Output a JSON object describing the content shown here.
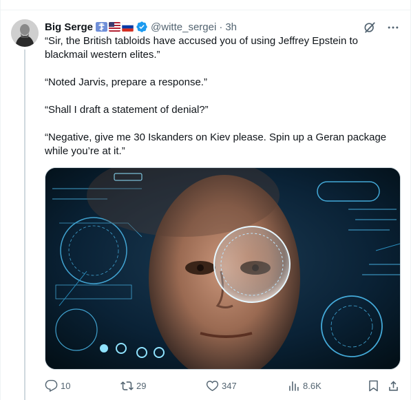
{
  "tweet": {
    "author_name": "Big Serge",
    "handle": "@witte_sergei",
    "separator": "·",
    "time": "3h",
    "paragraphs": [
      "“Sir, the British tabloids have accused you of using Jeffrey Epstein to blackmail western elites.”",
      "“Noted Jarvis, prepare a response.”",
      "“Shall I draft a statement of denial?”",
      "“Negative, give me 30 Iskanders on Kiev please. Spin up a Geran package while you’re at it.”"
    ]
  },
  "badges": [
    {
      "icon": "orthodox-cross-icon",
      "color": "#6f8fd8"
    },
    {
      "icon": "us-flag-icon",
      "color": "#b22234"
    },
    {
      "icon": "russia-flag-icon",
      "color": "#0039a6"
    }
  ],
  "verified_color": "#1d9bf0",
  "metrics": {
    "replies": "10",
    "reposts": "29",
    "likes": "347",
    "views": "8.6K"
  },
  "icons": {
    "more": "more-options-icon",
    "grok": "grok-icon",
    "reply": "reply-icon",
    "repost": "repost-icon",
    "like": "heart-icon",
    "views": "views-icon",
    "bookmark": "bookmark-icon",
    "share": "share-icon"
  }
}
